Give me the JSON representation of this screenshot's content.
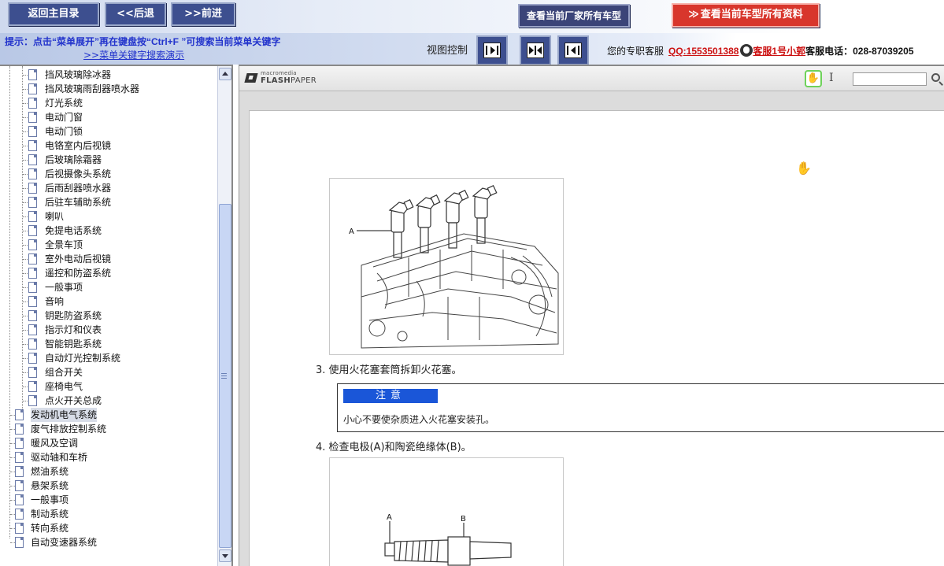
{
  "topbar": {
    "main_label": "返回主目录",
    "back_label": "<<后退",
    "forward_label": ">>前进",
    "factory_label": "查看当前厂家所有车型",
    "model_label": "查看当前车型所有资料",
    "model_arrow": "≫"
  },
  "hint": {
    "text": "提示：点击“菜单展开”再在键盘按“Ctrl+F ”可搜索当前菜单关键字",
    "link": ">>菜单关键字搜索演示"
  },
  "view_control": {
    "label": "视图控制"
  },
  "service": {
    "prefix": "您的专职客服",
    "qq": "QQ:1553501388",
    "kefu": "客服1号小郭",
    "tel": "客服电话：028-87039205"
  },
  "tree": {
    "children": [
      "挡风玻璃除冰器",
      "挡风玻璃雨刮器喷水器",
      "灯光系统",
      "电动门窗",
      "电动门锁",
      "电铬室内后视镜",
      "后玻璃除霜器",
      "后视摄像头系统",
      "后雨刮器喷水器",
      "后驻车辅助系统",
      "喇叭",
      "免提电话系统",
      "全景车顶",
      "室外电动后视镜",
      "遥控和防盗系统",
      "一般事项",
      "音响",
      "钥匙防盗系统",
      "指示灯和仪表",
      "智能钥匙系统",
      "自动灯光控制系统",
      "组合开关",
      "座椅电气",
      "点火开关总成"
    ],
    "top_level": [
      "发动机电气系统",
      "废气排放控制系统",
      "暖风及空调",
      "驱动轴和车桥",
      "燃油系统",
      "悬架系统",
      "一般事项",
      "制动系统",
      "转向系统",
      "自动变速器系统"
    ],
    "selected": "发动机电气系统"
  },
  "viewer": {
    "brand_small": "macromedia",
    "brand_big": "FLASH",
    "brand_big2": "PAPER",
    "text_tool": "I",
    "hand_glyph": "✋",
    "figure1_label_a": "A",
    "step3": "3. 使用火花塞套筒拆卸火花塞。",
    "caution_head": "注意",
    "caution_text": "小心不要使杂质进入火花塞安装孔。",
    "step4": "4. 检查电极(A)和陶瓷绝缘体(B)。",
    "figure2_label_a": "A",
    "figure2_label_b": "B"
  },
  "colors": {
    "nav_blue": "#3d4f8f",
    "model_red": "#d8362c",
    "hint_blue": "#2233cc",
    "caution_blue": "#1a56d8"
  }
}
